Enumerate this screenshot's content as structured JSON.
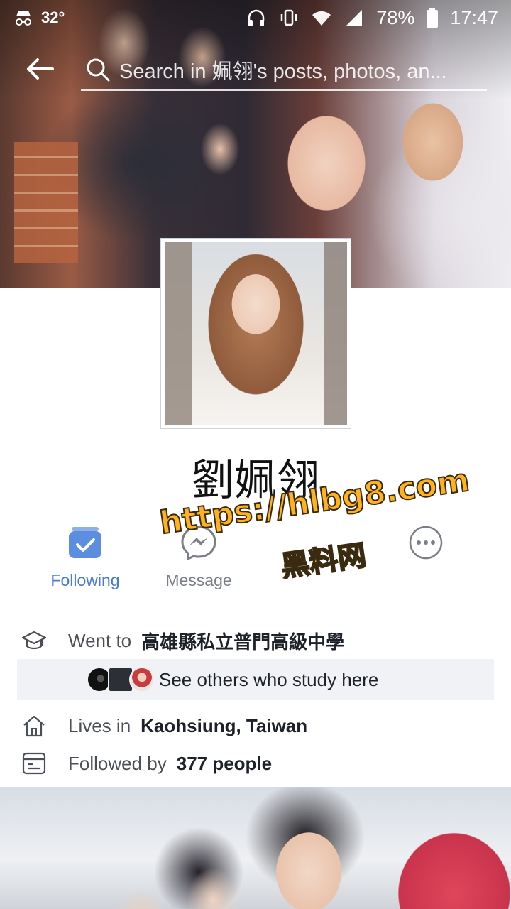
{
  "status_bar": {
    "temperature": "32°",
    "battery": "78%",
    "time": "17:47"
  },
  "search": {
    "placeholder": "Search in 姵翎's posts, photos, an..."
  },
  "profile": {
    "name": "劉姵翎"
  },
  "actions": {
    "following_label": "Following",
    "message_label": "Message"
  },
  "about": {
    "education_prefix": "Went to",
    "education_school": "高雄縣私立普門高級中學",
    "see_others": "See others who study here",
    "lives_prefix": "Lives in",
    "lives_place": "Kaohsiung, Taiwan",
    "followed_prefix": "Followed by",
    "followed_count": "377 people"
  },
  "watermark": {
    "url": "https://hlbg8.com",
    "cn": "黑料网"
  },
  "colors": {
    "accent": "#4b7bd0",
    "watermark": "#ffb21f"
  }
}
